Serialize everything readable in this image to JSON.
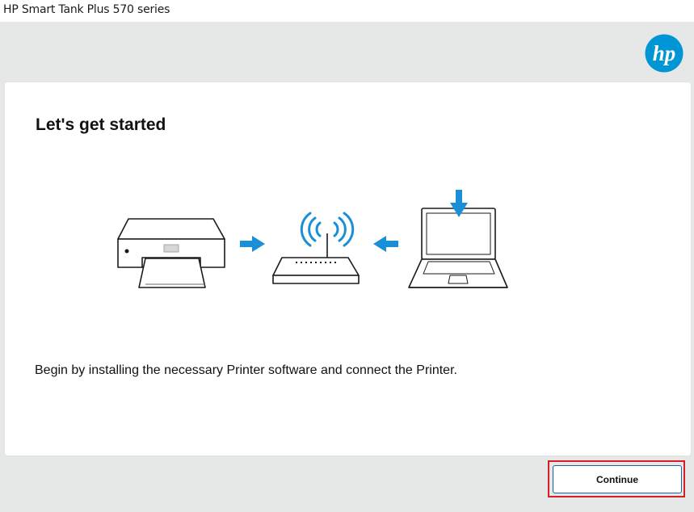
{
  "window": {
    "title": "HP Smart Tank Plus 570 series"
  },
  "brand": {
    "logo_text": "hp",
    "color": "#0096d6"
  },
  "main": {
    "heading": "Let's get started",
    "description": "Begin by installing the necessary Printer software and connect the Printer.",
    "illustration": {
      "icons": [
        "printer-icon",
        "arrow-right-icon",
        "wifi-router-icon",
        "arrow-left-icon",
        "laptop-icon",
        "download-arrow-icon"
      ],
      "accent_color": "#1a8fd8"
    }
  },
  "footer": {
    "continue_label": "Continue"
  }
}
